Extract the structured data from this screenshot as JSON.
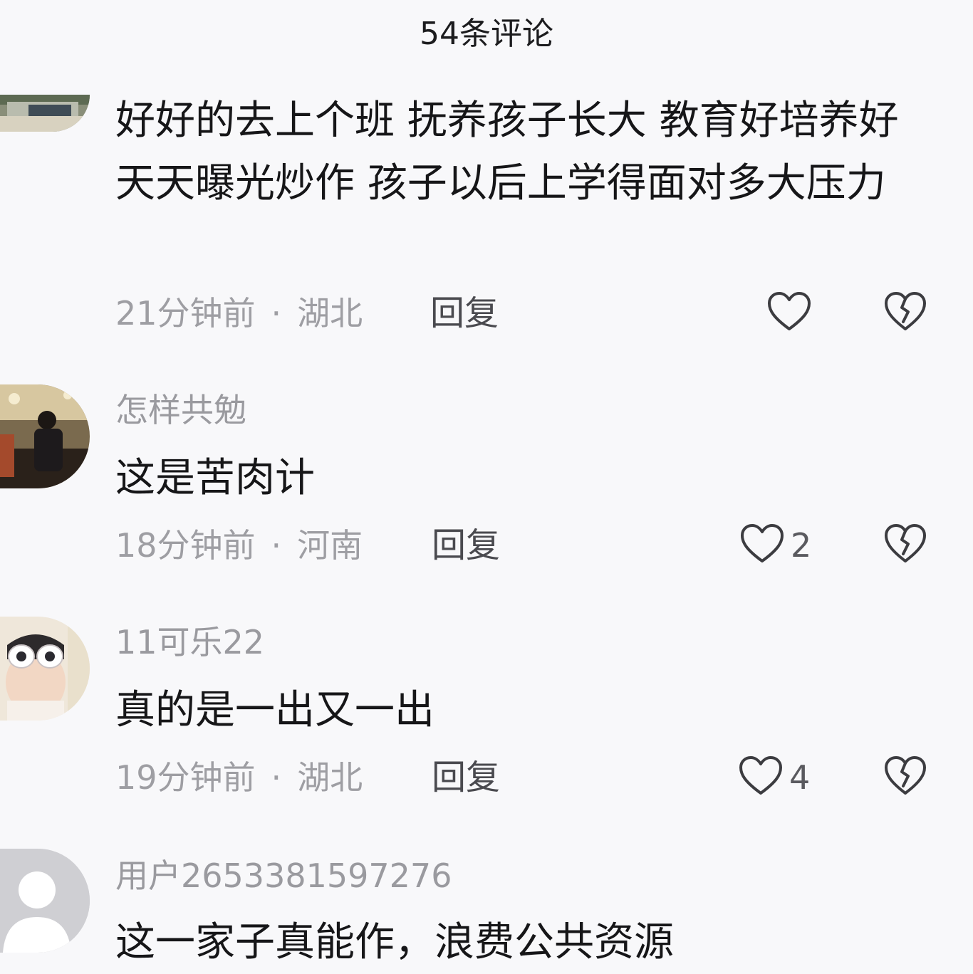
{
  "header": {
    "title": "54条评论"
  },
  "comments": [
    {
      "username": "",
      "content": "好好的去上个班  抚养孩子长大 教育好培养好 天天曝光炒作 孩子以后上学得面对多大压力",
      "time": "21分钟前",
      "location": "湖北",
      "reply_label": "回复",
      "likes": ""
    },
    {
      "username": "怎样共勉",
      "content": "这是苦肉计",
      "time": "18分钟前",
      "location": "河南",
      "reply_label": "回复",
      "likes": "2"
    },
    {
      "username": "11可乐22",
      "content": "真的是一出又一出",
      "time": "19分钟前",
      "location": "湖北",
      "reply_label": "回复",
      "likes": "4"
    },
    {
      "username": "用户2653381597276",
      "content": "这一家子真能作，浪费公共资源"
    }
  ],
  "meta_separator": "·",
  "icons": {
    "like": "heart-outline-icon",
    "dislike": "broken-heart-icon"
  }
}
